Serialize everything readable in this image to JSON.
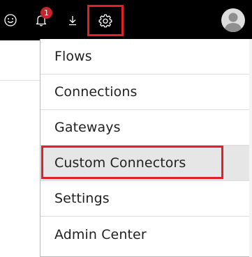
{
  "topbar": {
    "icons": {
      "feedback": "smiley-icon",
      "notifications": "bell-icon",
      "download": "download-icon",
      "settings": "gear-icon",
      "account": "avatar-icon"
    },
    "notification_count": "1"
  },
  "settings_menu": {
    "items": [
      {
        "label": "Flows"
      },
      {
        "label": "Connections"
      },
      {
        "label": "Gateways"
      },
      {
        "label": "Custom Connectors",
        "selected": true
      },
      {
        "label": "Settings"
      },
      {
        "label": "Admin Center"
      }
    ]
  },
  "colors": {
    "topbar_background": "#000000",
    "highlight_border": "#e3202a",
    "badge_background": "#c4262e",
    "selected_item_background": "#e6e6e6"
  }
}
